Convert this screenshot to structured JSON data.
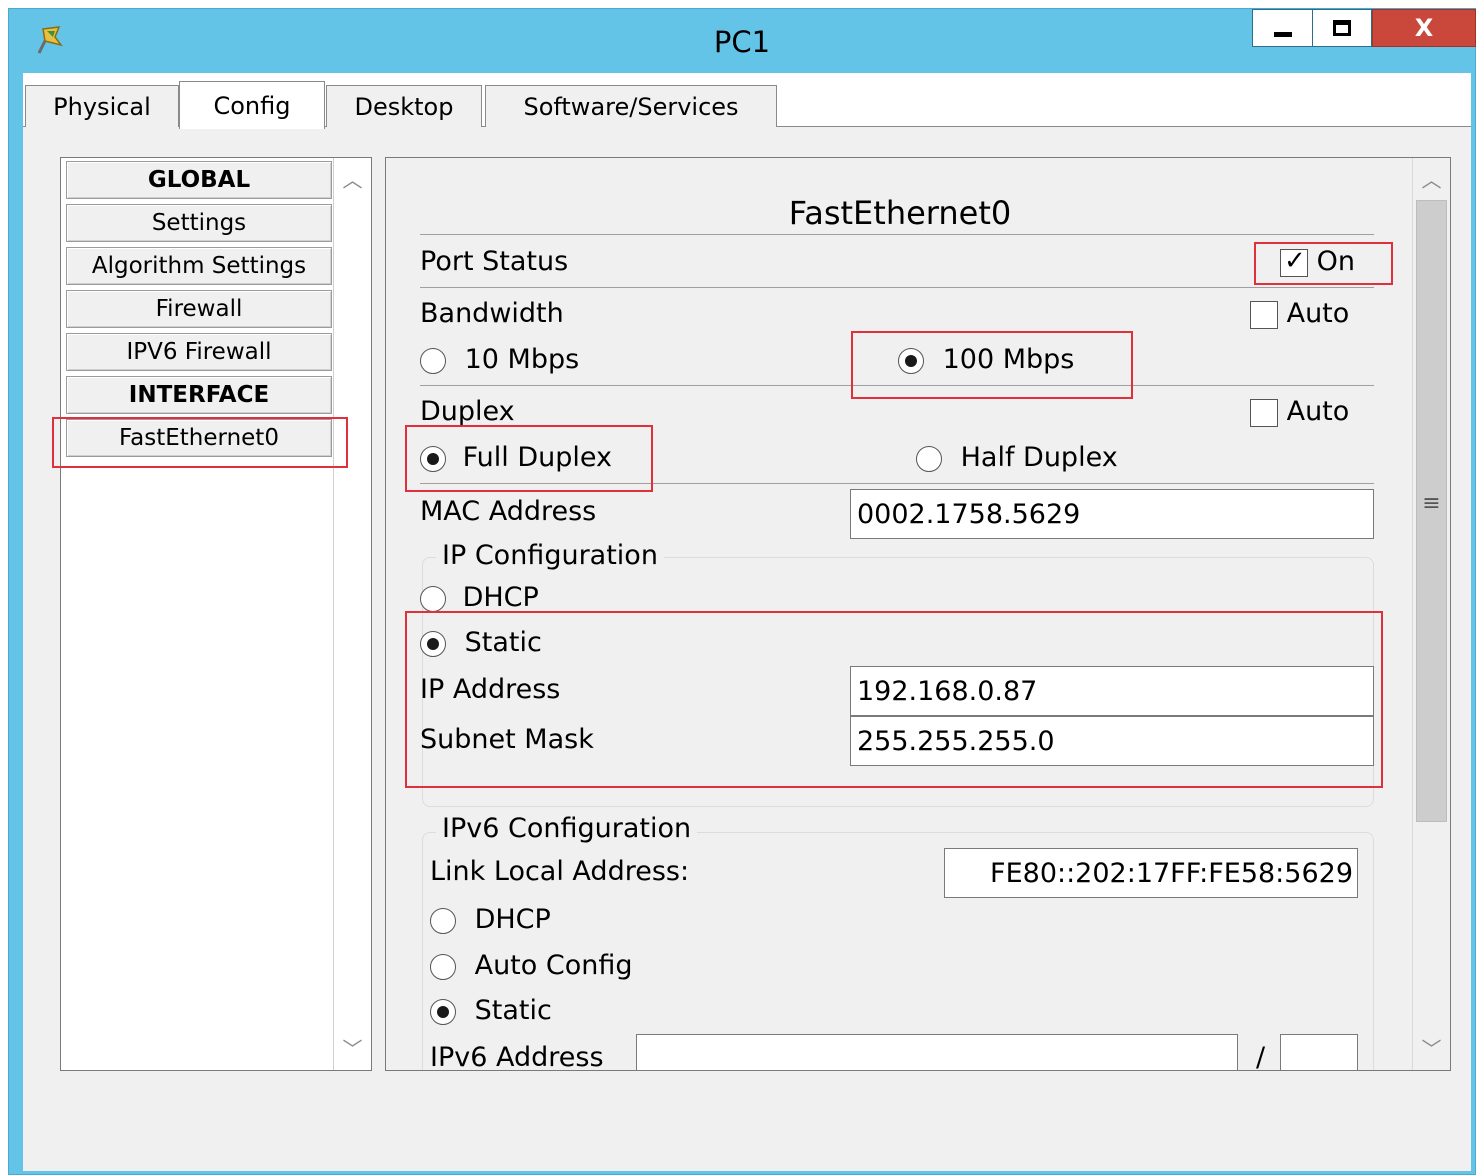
{
  "window": {
    "title": "PC1",
    "close_label": "X"
  },
  "tabs": [
    {
      "label": "Physical"
    },
    {
      "label": "Config"
    },
    {
      "label": "Desktop"
    },
    {
      "label": "Software/Services"
    }
  ],
  "nav": {
    "items": [
      {
        "label": "GLOBAL",
        "header": true
      },
      {
        "label": "Settings"
      },
      {
        "label": "Algorithm Settings"
      },
      {
        "label": "Firewall"
      },
      {
        "label": "IPV6 Firewall"
      },
      {
        "label": "INTERFACE",
        "header": true
      },
      {
        "label": "FastEthernet0"
      }
    ]
  },
  "panel": {
    "heading": "FastEthernet0",
    "port_status": {
      "label": "Port Status",
      "checkbox_label": "On",
      "checked": true
    },
    "bandwidth": {
      "label": "Bandwidth",
      "auto_label": "Auto",
      "auto_checked": false,
      "options": [
        {
          "label": "10 Mbps",
          "selected": false
        },
        {
          "label": "100 Mbps",
          "selected": true
        }
      ]
    },
    "duplex": {
      "label": "Duplex",
      "auto_label": "Auto",
      "auto_checked": false,
      "options": [
        {
          "label": "Full Duplex",
          "selected": true
        },
        {
          "label": "Half Duplex",
          "selected": false
        }
      ]
    },
    "mac": {
      "label": "MAC Address",
      "value": "0002.1758.5629"
    },
    "ip_config": {
      "legend": "IP Configuration",
      "dhcp_label": "DHCP",
      "dhcp_selected": false,
      "static_label": "Static",
      "static_selected": true,
      "ip_label": "IP Address",
      "ip_value": "192.168.0.87",
      "mask_label": "Subnet Mask",
      "mask_value": "255.255.255.0"
    },
    "ipv6_config": {
      "legend": "IPv6 Configuration",
      "link_local_label": "Link Local Address:",
      "link_local_value": "FE80::202:17FF:FE58:5629",
      "dhcp_label": "DHCP",
      "auto_label": "Auto Config",
      "static_label": "Static",
      "address_label": "IPv6 Address",
      "address_value": "",
      "prefix_separator": "/",
      "prefix_value": ""
    }
  },
  "colors": {
    "titlebar": "#63c4e8",
    "close_button": "#c9473b",
    "highlight": "#e0303b"
  }
}
